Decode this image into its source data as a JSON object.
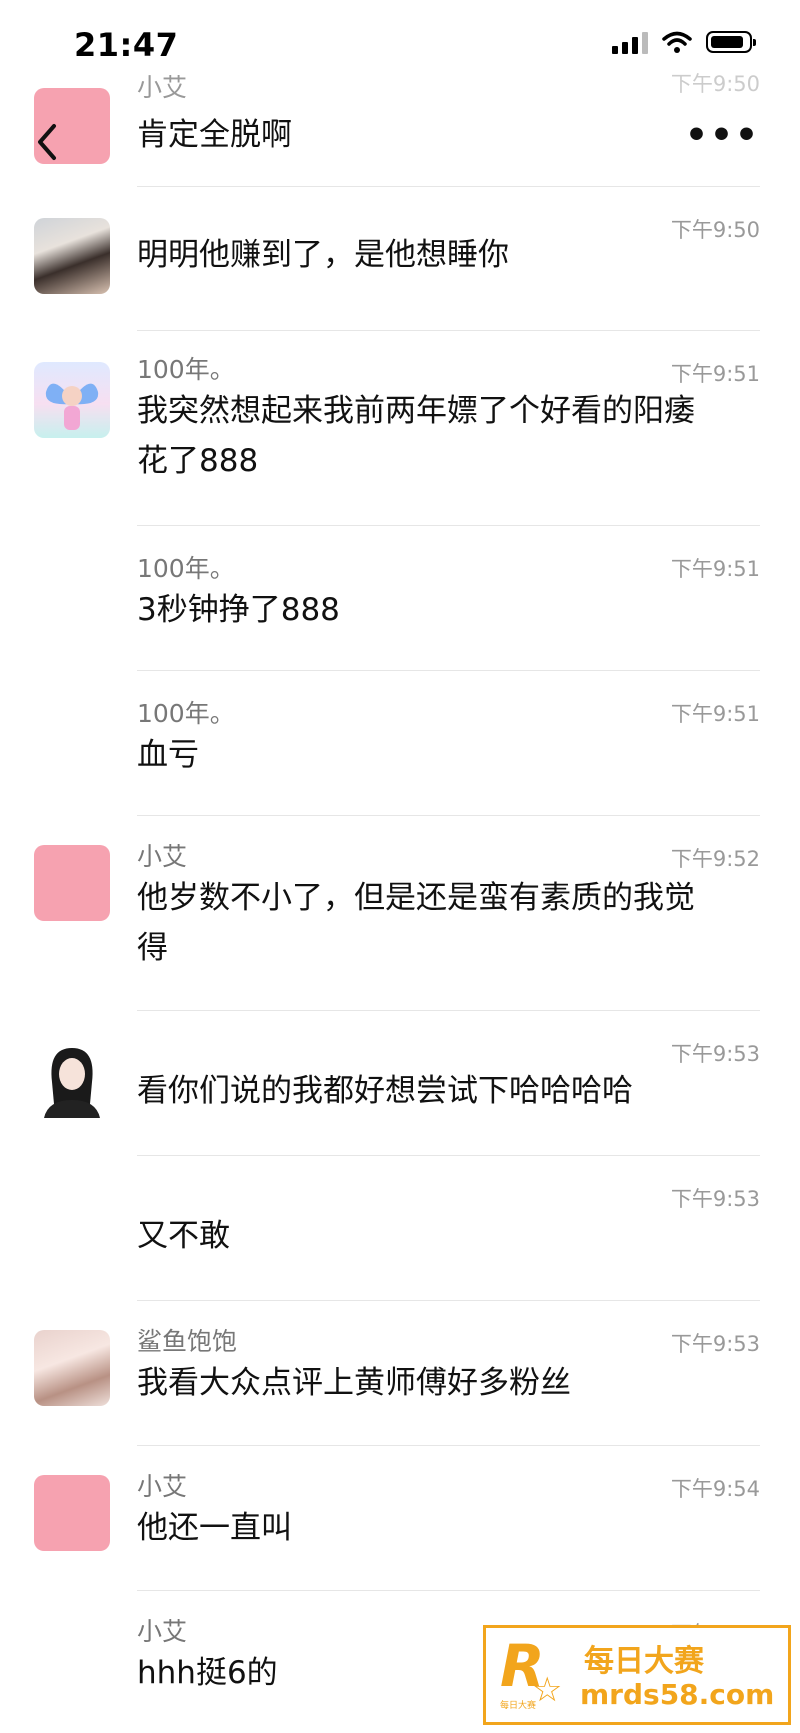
{
  "status_bar": {
    "time": "21:47"
  },
  "header": {
    "more_label": "•••"
  },
  "messages": [
    {
      "sender": "小艾",
      "time": "下午9:50",
      "text": "肯定全脱啊"
    },
    {
      "sender": "",
      "time": "下午9:50",
      "text": "明明他赚到了，是他想睡你"
    },
    {
      "sender": "100年。",
      "time": "下午9:51",
      "text": "我突然想起来我前两年嫖了个好看的阳痿",
      "text2": "花了888"
    },
    {
      "sender": "100年。",
      "time": "下午9:51",
      "text": "3秒钟挣了888"
    },
    {
      "sender": "100年。",
      "time": "下午9:51",
      "text": "血亏"
    },
    {
      "sender": "小艾",
      "time": "下午9:52",
      "text": "他岁数不小了，但是还是蛮有素质的我觉",
      "text2": "得"
    },
    {
      "sender": "",
      "time": "下午9:53",
      "text": "看你们说的我都好想尝试下哈哈哈哈"
    },
    {
      "sender": "",
      "time": "下午9:53",
      "text": "又不敢"
    },
    {
      "sender": "鲨鱼饱饱",
      "time": "下午9:53",
      "text": "我看大众点评上黄师傅好多粉丝"
    },
    {
      "sender": "小艾",
      "time": "下午9:54",
      "text": "他还一直叫"
    },
    {
      "sender": "小艾",
      "time": "下午9:54",
      "text": "hhh挺6的"
    }
  ],
  "watermark": {
    "logo_letter": "R",
    "logo_small": "每日大赛",
    "name": "每日大赛",
    "url": "mrds58.com",
    "color": "#f2a51c"
  },
  "colors": {
    "avatar_pink": "#f6a2b0",
    "divider": "#e6e6e6"
  }
}
